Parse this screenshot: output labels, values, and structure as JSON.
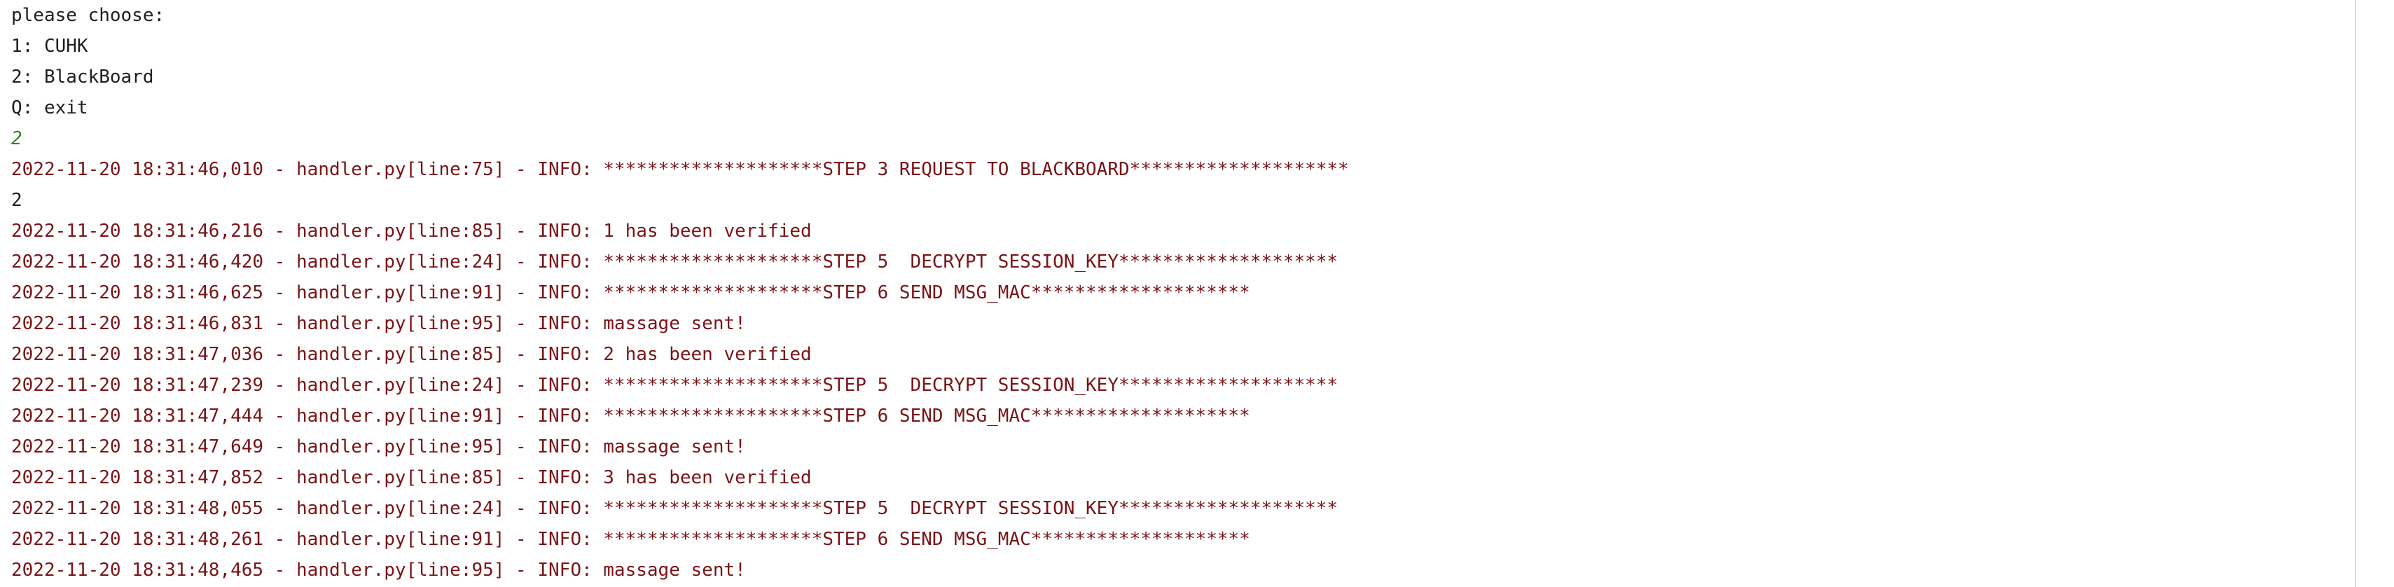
{
  "console": {
    "lines": [
      {
        "text": "please choose:",
        "stream": "stdout"
      },
      {
        "text": "1: CUHK",
        "stream": "stdout"
      },
      {
        "text": "2: BlackBoard",
        "stream": "stdout"
      },
      {
        "text": "Q: exit",
        "stream": "stdout"
      },
      {
        "text": "2",
        "stream": "stdin"
      },
      {
        "text": "2022-11-20 18:31:46,010 - handler.py[line:75] - INFO: ********************STEP 3 REQUEST TO BLACKBOARD********************",
        "stream": "stderr"
      },
      {
        "text": "2",
        "stream": "stdout"
      },
      {
        "text": "2022-11-20 18:31:46,216 - handler.py[line:85] - INFO: 1 has been verified",
        "stream": "stderr"
      },
      {
        "text": "2022-11-20 18:31:46,420 - handler.py[line:24] - INFO: ********************STEP 5  DECRYPT SESSION_KEY********************",
        "stream": "stderr"
      },
      {
        "text": "2022-11-20 18:31:46,625 - handler.py[line:91] - INFO: ********************STEP 6 SEND MSG_MAC********************",
        "stream": "stderr"
      },
      {
        "text": "2022-11-20 18:31:46,831 - handler.py[line:95] - INFO: massage sent!",
        "stream": "stderr"
      },
      {
        "text": "2022-11-20 18:31:47,036 - handler.py[line:85] - INFO: 2 has been verified",
        "stream": "stderr"
      },
      {
        "text": "2022-11-20 18:31:47,239 - handler.py[line:24] - INFO: ********************STEP 5  DECRYPT SESSION_KEY********************",
        "stream": "stderr"
      },
      {
        "text": "2022-11-20 18:31:47,444 - handler.py[line:91] - INFO: ********************STEP 6 SEND MSG_MAC********************",
        "stream": "stderr"
      },
      {
        "text": "2022-11-20 18:31:47,649 - handler.py[line:95] - INFO: massage sent!",
        "stream": "stderr"
      },
      {
        "text": "2022-11-20 18:31:47,852 - handler.py[line:85] - INFO: 3 has been verified",
        "stream": "stderr"
      },
      {
        "text": "2022-11-20 18:31:48,055 - handler.py[line:24] - INFO: ********************STEP 5  DECRYPT SESSION_KEY********************",
        "stream": "stderr"
      },
      {
        "text": "2022-11-20 18:31:48,261 - handler.py[line:91] - INFO: ********************STEP 6 SEND MSG_MAC********************",
        "stream": "stderr"
      },
      {
        "text": "2022-11-20 18:31:48,465 - handler.py[line:95] - INFO: massage sent!",
        "stream": "stderr"
      }
    ]
  },
  "colors": {
    "stdout": "#1f1f1f",
    "stdin": "#2b8a1b",
    "stderr": "#7a1418",
    "background": "#ffffff"
  }
}
